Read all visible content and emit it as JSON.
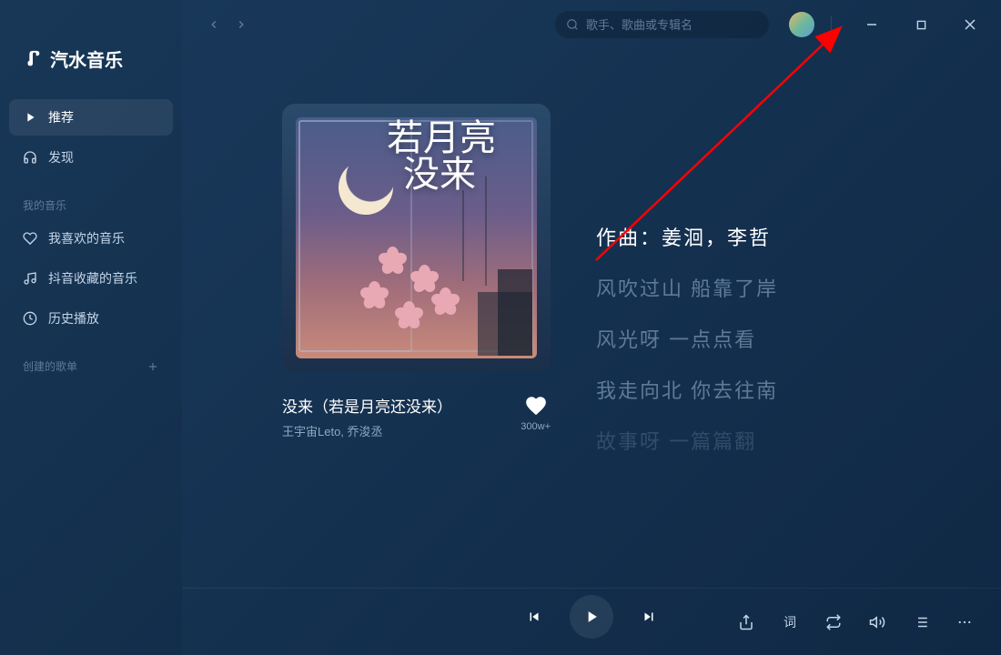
{
  "app_name": "汽水音乐",
  "search": {
    "placeholder": "歌手、歌曲或专辑名"
  },
  "sidebar": {
    "nav": [
      {
        "label": "推荐",
        "icon": "play"
      },
      {
        "label": "发现",
        "icon": "headphones"
      }
    ],
    "section_my_music": "我的音乐",
    "my_music_items": [
      {
        "label": "我喜欢的音乐",
        "icon": "heart"
      },
      {
        "label": "抖音收藏的音乐",
        "icon": "note"
      },
      {
        "label": "历史播放",
        "icon": "history"
      }
    ],
    "section_playlist": "创建的歌单"
  },
  "song": {
    "title_partial": "没来（若是月亮还没来）",
    "artist": "王宇宙Leto, 乔浚丞",
    "like_count": "300w+",
    "cover_text": "若月亮\n没来"
  },
  "lyrics": [
    {
      "text": "作曲：姜洄，李哲",
      "active": true
    },
    {
      "text": "风吹过山 船靠了岸",
      "active": false
    },
    {
      "text": "风光呀 一点点看",
      "active": false
    },
    {
      "text": "我走向北 你去往南",
      "active": false
    },
    {
      "text": "故事呀 一篇篇翻",
      "active": false,
      "faded": true
    }
  ],
  "player_right": {
    "lyr_btn": "词"
  }
}
